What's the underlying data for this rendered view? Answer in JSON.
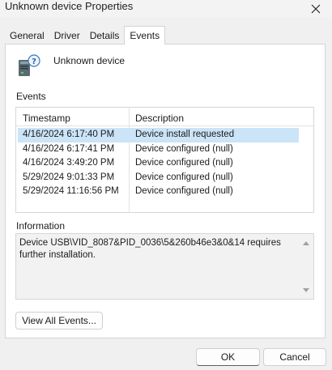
{
  "window": {
    "title": "Unknown device Properties",
    "close_icon": "close-icon"
  },
  "tabs": [
    {
      "label": "General"
    },
    {
      "label": "Driver"
    },
    {
      "label": "Details"
    },
    {
      "label": "Events",
      "active": true
    }
  ],
  "device": {
    "name": "Unknown device",
    "icon": "unknown-device-icon"
  },
  "events": {
    "label": "Events",
    "columns": {
      "timestamp": "Timestamp",
      "description": "Description"
    },
    "rows": [
      {
        "timestamp": "4/16/2024 6:17:40 PM",
        "description": "Device install requested",
        "selected": true
      },
      {
        "timestamp": "4/16/2024 6:17:41 PM",
        "description": "Device configured (null)"
      },
      {
        "timestamp": "4/16/2024 3:49:20 PM",
        "description": "Device configured (null)"
      },
      {
        "timestamp": "5/29/2024 9:01:33 PM",
        "description": "Device configured (null)"
      },
      {
        "timestamp": "5/29/2024 11:16:56 PM",
        "description": "Device configured (null)"
      }
    ]
  },
  "information": {
    "label": "Information",
    "text": "Device USB\\VID_8087&PID_0036\\5&260b46e3&0&14 requires further installation."
  },
  "buttons": {
    "view_all_events": "View All Events...",
    "ok": "OK",
    "cancel": "Cancel"
  },
  "colors": {
    "selection": "#cce4f7",
    "background": "#f0f0f0"
  }
}
